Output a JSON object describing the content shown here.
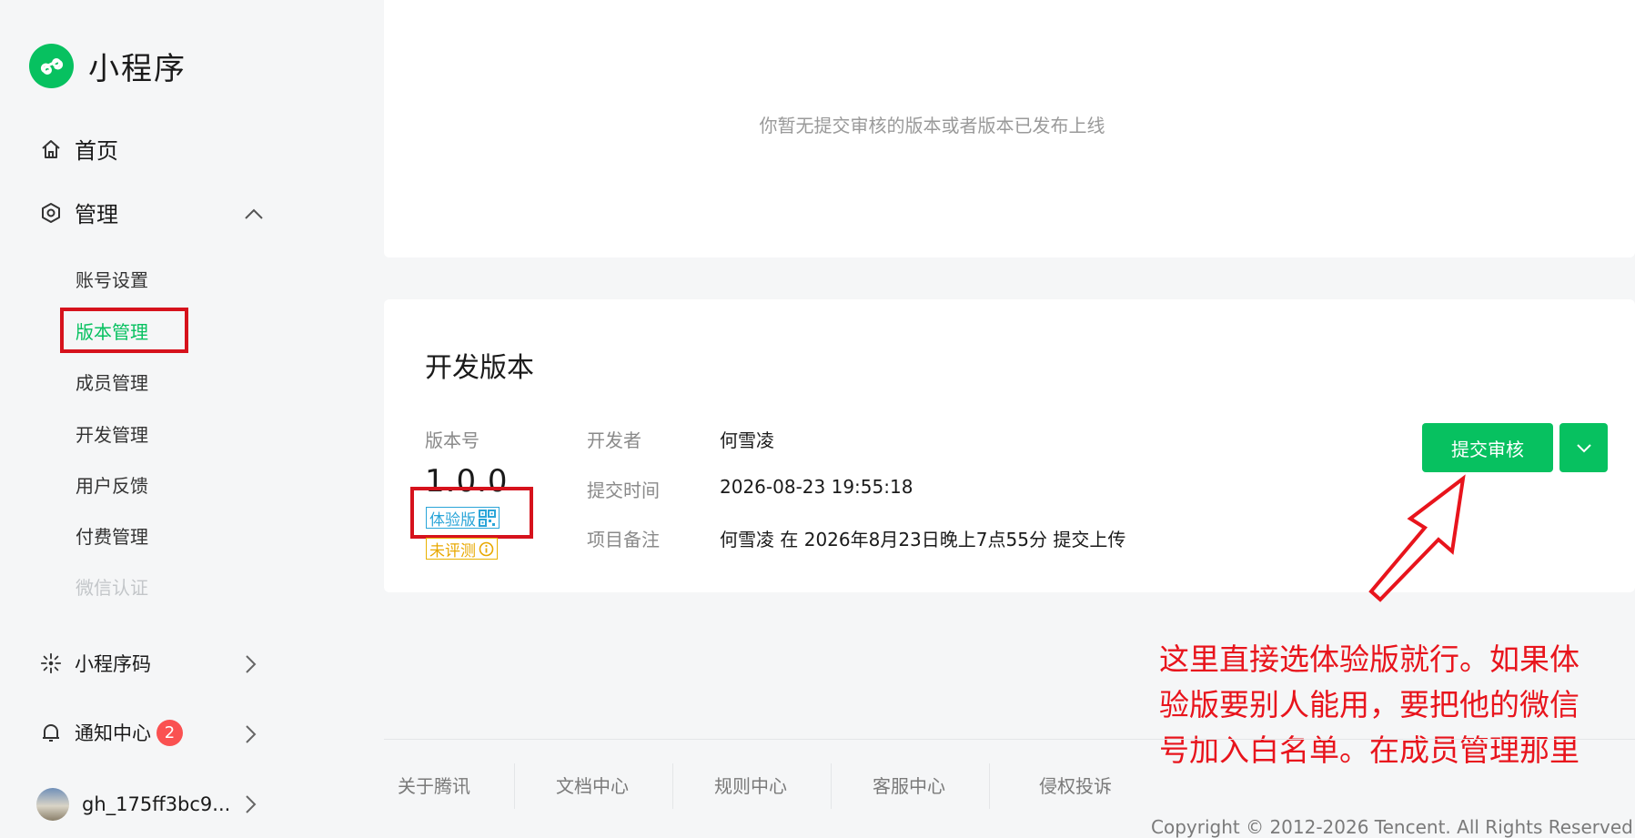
{
  "app": {
    "title": "小程序"
  },
  "sidebar": {
    "home": "首页",
    "manage": "管理",
    "sub_items": [
      "账号设置",
      "版本管理",
      "成员管理",
      "开发管理",
      "用户反馈",
      "付费管理",
      "微信认证"
    ],
    "active_item": "版本管理",
    "mini_code": "小程序码",
    "notifications": {
      "label": "通知中心",
      "count": "2"
    },
    "account": "gh_175ff3bc9..."
  },
  "top_card": {
    "empty_text": "你暂无提交审核的版本或者版本已发布上线"
  },
  "dev_version": {
    "title": "开发版本",
    "version_label": "版本号",
    "version": "1.0.0",
    "trial_tag": "体验版",
    "unrated_tag": "未评测",
    "developer_label": "开发者",
    "developer": "何雪凌",
    "submit_time_label": "提交时间",
    "submit_time": "2026-08-23 19:55:18",
    "remark_label": "项目备注",
    "remark": "何雪凌 在 2026年8月23日晚上7点55分 提交上传",
    "submit_button": "提交审核"
  },
  "annotation": {
    "line1": "这里直接选体验版就行。如果体",
    "line2": "验版要别人能用，要把他的微信",
    "line3": "号加入白名单。在成员管理那里"
  },
  "footer": {
    "links": [
      "关于腾讯",
      "文档中心",
      "规则中心",
      "客服中心",
      "侵权投诉"
    ],
    "copyright": "Copyright © 2012-2026 Tencent. All Rights Reserved."
  },
  "colors": {
    "brand_green": "#07c160",
    "annotation_red": "#e8141c",
    "trial_blue": "#2aa5d8",
    "unrated_yellow": "#e8a800",
    "badge_red": "#fa5151"
  }
}
